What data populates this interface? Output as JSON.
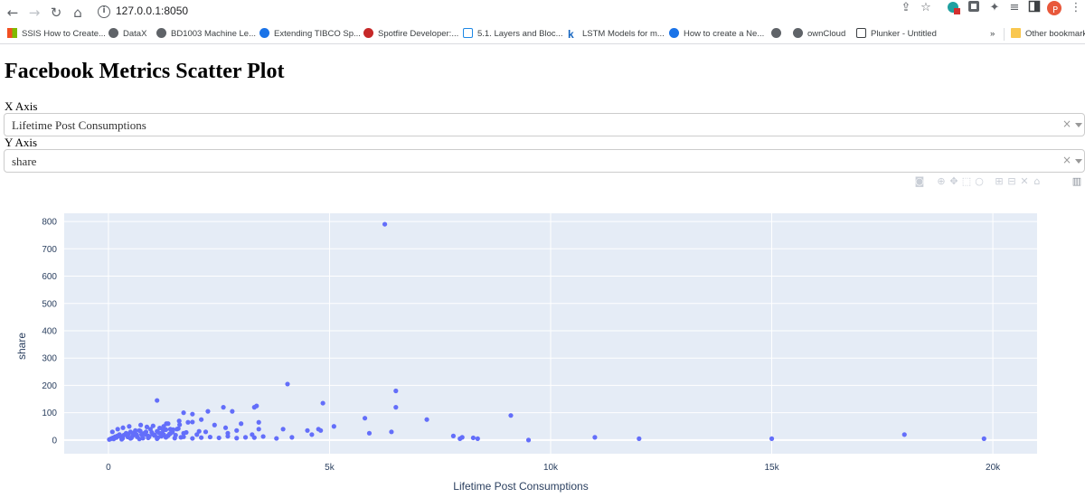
{
  "browser": {
    "url": "127.0.0.1:8050",
    "profile_initial": "P",
    "bookmarks": [
      {
        "label": "SSIS How to Create...",
        "icon": "microsoft-icon",
        "color": "#f25022"
      },
      {
        "label": "DataX",
        "icon": "globe-icon",
        "color": "#5f6368"
      },
      {
        "label": "BD1003 Machine Le...",
        "icon": "globe-icon",
        "color": "#5f6368"
      },
      {
        "label": "Extending TIBCO Sp...",
        "icon": "edge-icon",
        "color": "#1a73e8"
      },
      {
        "label": "Spotfire Developer:...",
        "icon": "target-icon",
        "color": "#c62828"
      },
      {
        "label": "5.1. Layers and Bloc...",
        "icon": "d2l-icon",
        "color": "#1e88e5"
      },
      {
        "label": "LSTM Models for m...",
        "icon": "k-icon",
        "color": "#1565c0"
      },
      {
        "label": "How to create a Ne...",
        "icon": "edge-icon",
        "color": "#1a73e8"
      },
      {
        "label": "",
        "icon": "globe-icon",
        "color": "#5f6368"
      },
      {
        "label": "ownCloud",
        "icon": "globe-icon",
        "color": "#5f6368"
      },
      {
        "label": "Plunker - Untitled",
        "icon": "download-icon",
        "color": "#3c4043"
      }
    ],
    "bookmarks_more": "»",
    "other_bookmarks": "Other bookmarks"
  },
  "page": {
    "title": "Facebook Metrics Scatter Plot",
    "x_axis_label": "X Axis",
    "x_axis_value": "Lifetime Post Consumptions",
    "y_axis_label": "Y Axis",
    "y_axis_value": "share",
    "clear_glyph": "×"
  },
  "chart_data": {
    "type": "scatter",
    "title": "",
    "xlabel": "Lifetime Post Consumptions",
    "ylabel": "share",
    "xlim": [
      -1000,
      21000
    ],
    "ylim": [
      -50,
      830
    ],
    "x_ticks": [
      0,
      5000,
      10000,
      15000,
      20000
    ],
    "x_tick_labels": [
      "0",
      "5k",
      "10k",
      "15k",
      "20k"
    ],
    "y_ticks": [
      0,
      100,
      200,
      300,
      400,
      500,
      600,
      700,
      800
    ],
    "y_tick_labels": [
      "0",
      "100",
      "200",
      "300",
      "400",
      "500",
      "600",
      "700",
      "800"
    ],
    "grid": true,
    "colors": {
      "marker": "#636efa",
      "plot_bg": "#e5ecf6",
      "grid": "#ffffff"
    },
    "series": [
      {
        "name": "",
        "x": [
          20,
          60,
          100,
          150,
          200,
          250,
          300,
          350,
          400,
          450,
          500,
          550,
          600,
          650,
          700,
          750,
          800,
          850,
          900,
          950,
          1000,
          1050,
          1100,
          1150,
          1200,
          1250,
          1300,
          1350,
          1400,
          1450,
          120,
          180,
          260,
          320,
          380,
          440,
          520,
          580,
          640,
          720,
          780,
          840,
          920,
          980,
          1040,
          1120,
          1180,
          1240,
          1320,
          1380,
          1440,
          1520,
          1580,
          1640,
          1700,
          90,
          210,
          330,
          470,
          610,
          730,
          870,
          1010,
          1160,
          1310,
          1460,
          1610,
          1760,
          1900,
          2050,
          300,
          500,
          700,
          900,
          1100,
          1300,
          1500,
          1700,
          1900,
          2100,
          2300,
          2500,
          2700,
          2900,
          3100,
          3300,
          3500,
          3800,
          1100,
          1700,
          1900,
          2100,
          2600,
          2650,
          2800,
          3000,
          3300,
          3350,
          3400,
          2400,
          2200,
          1600,
          1400,
          1250,
          1800,
          2000,
          2900,
          3250,
          3400,
          2700,
          1350,
          1550,
          2250,
          4050,
          3950,
          4150,
          4500,
          4600,
          4750,
          4850,
          5100,
          6250,
          4800,
          6500,
          6500,
          5900,
          5800,
          6400,
          7200,
          7800,
          7950,
          8000,
          8250,
          8350,
          9100,
          9500,
          11000,
          12000,
          15000,
          18000,
          19800
        ],
        "y": [
          2,
          5,
          8,
          12,
          15,
          20,
          10,
          18,
          25,
          22,
          30,
          16,
          28,
          12,
          35,
          20,
          24,
          30,
          15,
          40,
          22,
          18,
          32,
          26,
          14,
          20,
          38,
          16,
          24,
          30,
          4,
          9,
          14,
          6,
          20,
          11,
          8,
          26,
          19,
          33,
          7,
          21,
          12,
          28,
          17,
          9,
          24,
          36,
          13,
          22,
          29,
          18,
          42,
          10,
          25,
          30,
          40,
          45,
          50,
          35,
          55,
          48,
          52,
          44,
          60,
          38,
          56,
          28,
          66,
          32,
          3,
          6,
          4,
          8,
          5,
          10,
          7,
          12,
          6,
          9,
          11,
          8,
          14,
          7,
          10,
          9,
          13,
          6,
          145,
          100,
          95,
          75,
          120,
          45,
          105,
          60,
          120,
          125,
          65,
          55,
          30,
          70,
          40,
          50,
          65,
          20,
          35,
          20,
          40,
          25,
          60,
          40,
          105,
          205,
          40,
          10,
          35,
          20,
          40,
          135,
          50,
          790,
          35,
          120,
          180,
          25,
          80,
          30,
          75,
          15,
          5,
          10,
          8,
          5,
          90,
          0,
          10,
          5,
          5,
          20,
          5
        ]
      }
    ]
  }
}
